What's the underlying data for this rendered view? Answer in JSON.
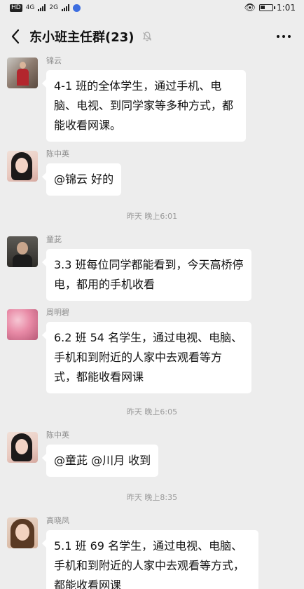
{
  "status_bar": {
    "hd_label": "HD",
    "net1": "4G",
    "net2": "2G",
    "time": "1:01"
  },
  "header": {
    "title": "东小班主任群(23)",
    "back_icon": "chevron-left-icon",
    "mute_icon": "bell-off-icon",
    "more_icon": "more-horizontal-icon"
  },
  "messages": [
    {
      "sender": "锦云",
      "text": "4-1 班的全体学生，通过手机、电脑、电视、到同学家等多种方式，都能收看网课。"
    },
    {
      "sender": "陈中英",
      "text": "@锦云  好的"
    },
    {
      "sender": "童茈",
      "text": "3.3 班每位同学都能看到，今天高桥停电，都用的手机收看"
    },
    {
      "sender": "周明碧",
      "text": "6.2 班 54 名学生，通过电视、电脑、手机和到附近的人家中去观看等方式，都能收看网课"
    },
    {
      "sender": "陈中英",
      "text": "@童茈  @川月   收到"
    },
    {
      "sender": "高晓凤",
      "text": "5.1 班 69 名学生，通过电视、电脑、手机和到附近的人家中去观看等方式，都能收看网课"
    }
  ],
  "time_dividers": [
    "昨天 晚上6:01",
    "昨天 晚上6:05",
    "昨天 晚上8:35"
  ]
}
